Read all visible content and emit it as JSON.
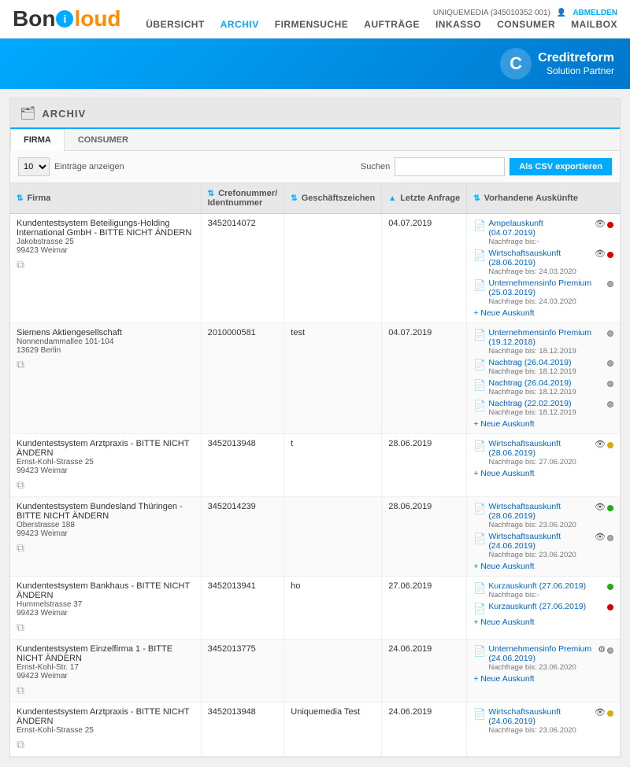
{
  "header": {
    "logo_bon": "Bon",
    "logo_i": "i",
    "logo_cloud": "loud",
    "user_id": "UNIQUEMEDIA (345010352 001)",
    "abmelden_label": "ABMELDEN",
    "nav": [
      {
        "label": "ÜBERSICHT",
        "active": false,
        "id": "uebersicht"
      },
      {
        "label": "ARCHIV",
        "active": true,
        "id": "archiv"
      },
      {
        "label": "FIRMENSUCHE",
        "active": false,
        "id": "firmensuche"
      },
      {
        "label": "AUFTRÄGE",
        "active": false,
        "id": "auftraege"
      },
      {
        "label": "INKASSO",
        "active": false,
        "id": "inkasso"
      },
      {
        "label": "CONSUMER",
        "active": false,
        "id": "consumer"
      },
      {
        "label": "MAILBOX",
        "active": false,
        "id": "mailbox"
      }
    ]
  },
  "creditreform": {
    "c_letter": "C",
    "line1": "Creditreform",
    "line2": "Solution Partner"
  },
  "page": {
    "title": "ARCHIV"
  },
  "tabs": [
    {
      "label": "FIRMA",
      "active": true
    },
    {
      "label": "CONSUMER",
      "active": false
    }
  ],
  "controls": {
    "entries_value": "10",
    "entries_label": "Einträge anzeigen",
    "search_label": "Suchen",
    "search_placeholder": "",
    "export_label": "Als CSV exportieren"
  },
  "table": {
    "headers": [
      {
        "label": "Firma",
        "sortable": true
      },
      {
        "label": "Crefonummer/ Identnummer",
        "sortable": true
      },
      {
        "label": "Geschäftszeichen",
        "sortable": true
      },
      {
        "label": "Letzte Anfrage",
        "sortable": true
      },
      {
        "label": "Vorhandene Auskünfte",
        "sortable": true
      }
    ],
    "rows": [
      {
        "firma": "Kundentestsystem Beteiligungs-Holding International GmbH - BITTE NICHT ÄNDERN",
        "strasse": "Jakobstrasse 25",
        "ort": "99423 Weimar",
        "crefo": "3452014072",
        "geschaeftszeichen": "",
        "letzte_anfrage": "04.07.2019",
        "auskuenfte": [
          {
            "label": "Ampelauskunft (04.07.2019)",
            "sub": "Nachfrage bis:-",
            "icons": [
              "eye",
              "dot-red"
            ],
            "type": "link"
          },
          {
            "label": "Wirtschaftsauskunft (28.06.2019)",
            "sub": "Nachfrage bis: 24.03.2020",
            "icons": [
              "eye",
              "dot-red"
            ],
            "type": "link"
          },
          {
            "label": "Unternehmensinfo Premium (25.03.2019)",
            "sub": "Nachfrage bis: 24.03.2020",
            "icons": [
              "dot-gray"
            ],
            "type": "link"
          }
        ],
        "neue_auskunft": true
      },
      {
        "firma": "Siemens Aktiengesellschaft",
        "strasse": "Nonnendammallee 101-104",
        "ort": "13629 Berlin",
        "crefo": "2010000581",
        "geschaeftszeichen": "test",
        "letzte_anfrage": "04.07.2019",
        "auskuenfte": [
          {
            "label": "Unternehmensinfo Premium (19.12.2018)",
            "sub": "Nachfrage bis: 18.12.2019",
            "icons": [
              "dot-gray"
            ],
            "type": "link"
          },
          {
            "label": "Nachtrag (26.04.2019)",
            "sub": "Nachfrage bis: 18.12.2019",
            "icons": [
              "dot-gray"
            ],
            "type": "link"
          },
          {
            "label": "Nachtrag (26.04.2019)",
            "sub": "Nachfrage bis: 18.12.2019",
            "icons": [
              "dot-gray"
            ],
            "type": "link"
          },
          {
            "label": "Nachtrag (22.02.2019)",
            "sub": "Nachfrage bis: 18.12.2019",
            "icons": [
              "dot-gray"
            ],
            "type": "link"
          }
        ],
        "neue_auskunft": true
      },
      {
        "firma": "Kundentestsystem Arztpraxis - BITTE NICHT ÄNDERN",
        "strasse": "Ernst-Kohl-Strasse 25",
        "ort": "99423 Weimar",
        "crefo": "3452013948",
        "geschaeftszeichen": "t",
        "letzte_anfrage": "28.06.2019",
        "auskuenfte": [
          {
            "label": "Wirtschaftsauskunft (28.06.2019)",
            "sub": "Nachfrage bis: 27.06.2020",
            "icons": [
              "eye",
              "dot-yellow"
            ],
            "type": "link"
          }
        ],
        "neue_auskunft": true
      },
      {
        "firma": "Kundentestsystem Bundesland Thüringen - BITTE NICHT ÄNDERN",
        "strasse": "Oberstrasse 188",
        "ort": "99423 Weimar",
        "crefo": "3452014239",
        "geschaeftszeichen": "",
        "letzte_anfrage": "28.06.2019",
        "auskuenfte": [
          {
            "label": "Wirtschaftsauskunft (28.06.2019)",
            "sub": "Nachfrage bis: 23.06.2020",
            "icons": [
              "eye",
              "dot-green"
            ],
            "type": "link"
          },
          {
            "label": "Wirtschaftsauskunft (24.06.2019)",
            "sub": "Nachfrage bis: 23.06.2020",
            "icons": [
              "eye",
              "dot-gray"
            ],
            "type": "link"
          }
        ],
        "neue_auskunft": true
      },
      {
        "firma": "Kundentestsystem Bankhaus - BITTE NICHT ÄNDERN",
        "strasse": "Hummelstrasse 37",
        "ort": "99423 Weimar",
        "crefo": "3452013941",
        "geschaeftszeichen": "ho",
        "letzte_anfrage": "27.06.2019",
        "auskuenfte": [
          {
            "label": "Kurzauskunft (27.06.2019)",
            "sub": "Nachfrage bis:-",
            "icons": [
              "dot-green"
            ],
            "type": "link"
          },
          {
            "label": "Kurzauskunft (27.06.2019)",
            "sub": "",
            "icons": [
              "dot-red"
            ],
            "type": "link"
          }
        ],
        "neue_auskunft": true
      },
      {
        "firma": "Kundentestsystem Einzelfirma 1 - BITTE NICHT ÄNDERN",
        "strasse": "Ernst-Kohl-Str. 17",
        "ort": "99423 Weimar",
        "crefo": "3452013775",
        "geschaeftszeichen": "",
        "letzte_anfrage": "24.06.2019",
        "auskuenfte": [
          {
            "label": "Unternehmensinfo Premium (24.06.2019)",
            "sub": "Nachfrage bis: 23.06.2020",
            "icons": [
              "gear",
              "dot-gray"
            ],
            "type": "link"
          }
        ],
        "neue_auskunft": true
      },
      {
        "firma": "Kundentestsystem Arztpraxis - BITTE NICHT ÄNDERN",
        "strasse": "Ernst-Kohl-Strasse 25",
        "ort": "",
        "crefo": "3452013948",
        "geschaeftszeichen": "Uniquemedia Test",
        "letzte_anfrage": "24.06.2019",
        "auskuenfte": [
          {
            "label": "Wirtschaftsauskunft (24.06.2019)",
            "sub": "Nachfrage bis: 23.06.2020",
            "icons": [
              "eye",
              "dot-yellow"
            ],
            "type": "link"
          }
        ],
        "neue_auskunft": false
      }
    ]
  }
}
